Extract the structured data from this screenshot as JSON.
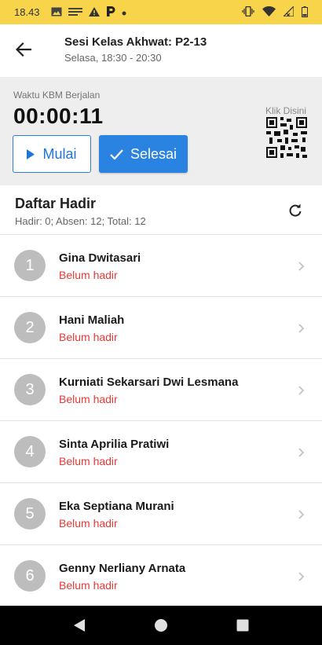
{
  "status_bar": {
    "time": "18.43",
    "icons": [
      "image-icon",
      "news-icon",
      "warning-icon",
      "parking-icon",
      "dot-icon",
      "vibrate-icon",
      "wifi-icon",
      "signal-icon",
      "battery-icon"
    ]
  },
  "app_bar": {
    "title": "Sesi Kelas Akhwat: P2-13",
    "subtitle": "Selasa, 18:30 - 20:30"
  },
  "timer": {
    "label": "Waktu KBM Berjalan",
    "value": "00:00:11",
    "start_label": "Mulai",
    "finish_label": "Selesai",
    "qr_label": "Klik Disini"
  },
  "attendance": {
    "title": "Daftar Hadir",
    "summary": "Hadir: 0; Absen: 12; Total: 12",
    "items": [
      {
        "number": "1",
        "name": "Gina Dwitasari",
        "status": "Belum hadir"
      },
      {
        "number": "2",
        "name": "Hani Maliah",
        "status": "Belum hadir"
      },
      {
        "number": "3",
        "name": "Kurniati Sekarsari Dwi Lesmana",
        "status": "Belum hadir"
      },
      {
        "number": "4",
        "name": "Sinta Aprilia Pratiwi",
        "status": "Belum hadir"
      },
      {
        "number": "5",
        "name": "Eka Septiana Murani",
        "status": "Belum hadir"
      },
      {
        "number": "6",
        "name": "Genny Nerliany Arnata",
        "status": "Belum hadir"
      }
    ]
  },
  "colors": {
    "status_bar": "#f7d449",
    "accent": "#2a83e0",
    "absent": "#e53935",
    "avatar": "#bdbdbd"
  }
}
